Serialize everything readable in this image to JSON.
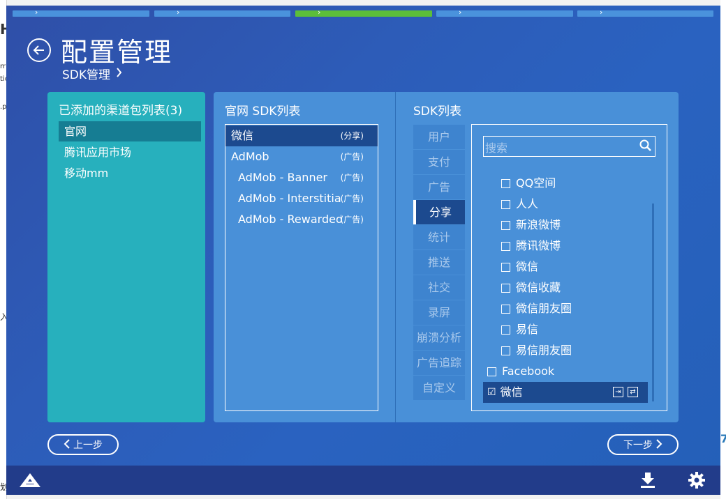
{
  "background": {
    "left_fragments": [
      "H",
      "rr",
      "tic",
      ".p",
      "入",
      "划"
    ],
    "right_fragment": "7"
  },
  "progress_steps": [
    {
      "state": "done"
    },
    {
      "state": "done"
    },
    {
      "state": "active"
    },
    {
      "state": "pending"
    },
    {
      "state": "pending"
    }
  ],
  "header": {
    "back_icon": "back-arrow-icon",
    "title": "配置管理",
    "breadcrumb": "SDK管理",
    "breadcrumb_icon": "chevron-right-icon"
  },
  "channels": {
    "title": "已添加的渠道包列表(3)",
    "items": [
      {
        "label": "官网",
        "selected": true
      },
      {
        "label": "腾讯应用市场",
        "selected": false
      },
      {
        "label": "移动mm",
        "selected": false
      }
    ]
  },
  "sdk_panel": {
    "title": "官网 SDK列表",
    "items": [
      {
        "name": "微信",
        "tag": "(分享)",
        "selected": true,
        "sub": false
      },
      {
        "name": "AdMob",
        "tag": "(广告)",
        "selected": false,
        "sub": false
      },
      {
        "name": "AdMob - Banner",
        "tag": "(广告)",
        "selected": false,
        "sub": true
      },
      {
        "name": "AdMob - Interstitial",
        "tag": "(广告)",
        "selected": false,
        "sub": true
      },
      {
        "name": "AdMob - Rewarded",
        "tag": "(广告)",
        "selected": false,
        "sub": true
      }
    ]
  },
  "sdk_list": {
    "title": "SDK列表",
    "categories": [
      {
        "label": "用户",
        "active": false
      },
      {
        "label": "支付",
        "active": false
      },
      {
        "label": "广告",
        "active": false
      },
      {
        "label": "分享",
        "active": true
      },
      {
        "label": "统计",
        "active": false
      },
      {
        "label": "推送",
        "active": false
      },
      {
        "label": "社交",
        "active": false
      },
      {
        "label": "录屏",
        "active": false
      },
      {
        "label": "崩溃分析",
        "active": false
      },
      {
        "label": "广告追踪",
        "active": false
      },
      {
        "label": "自定义",
        "active": false
      }
    ],
    "search": {
      "placeholder": "搜索",
      "icon": "search-icon"
    },
    "items": [
      {
        "label": "QQ空间",
        "checked": false,
        "indent": true
      },
      {
        "label": "人人",
        "checked": false,
        "indent": true
      },
      {
        "label": "新浪微博",
        "checked": false,
        "indent": true
      },
      {
        "label": "腾讯微博",
        "checked": false,
        "indent": true
      },
      {
        "label": "微信",
        "checked": false,
        "indent": true
      },
      {
        "label": "微信收藏",
        "checked": false,
        "indent": true
      },
      {
        "label": "微信朋友圈",
        "checked": false,
        "indent": true
      },
      {
        "label": "易信",
        "checked": false,
        "indent": true
      },
      {
        "label": "易信朋友圈",
        "checked": false,
        "indent": true
      },
      {
        "label": "Facebook",
        "checked": false,
        "indent": false
      },
      {
        "label": "微信",
        "checked": true,
        "indent": false
      }
    ]
  },
  "nav": {
    "prev_label": "上一步",
    "next_label": "下一步"
  },
  "footer": {
    "logo_icon": "app-logo-icon",
    "download_icon": "download-icon",
    "settings_icon": "gear-icon"
  },
  "colors": {
    "progress_done": "#4a92dc",
    "progress_active": "#5cbe3a",
    "channel_panel": "#27b0bd",
    "channel_selected": "#167d93",
    "sdk_panel": "#4990d8",
    "row_selected": "#1c4a8f",
    "footer": "#223c8a"
  }
}
